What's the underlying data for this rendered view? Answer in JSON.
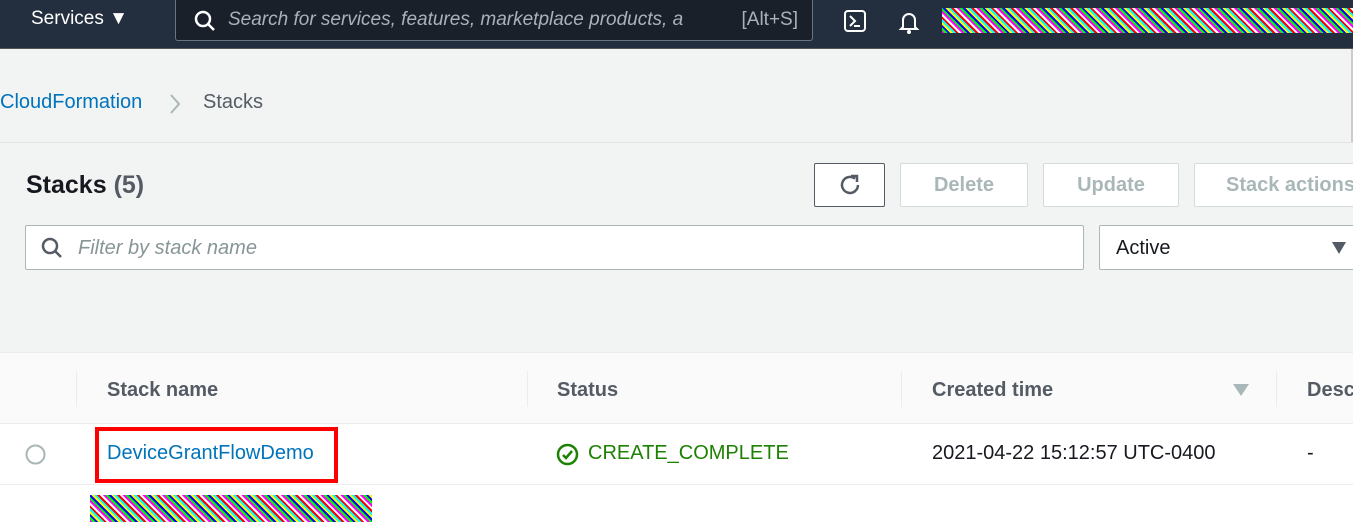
{
  "nav": {
    "services_label": "Services ▼",
    "search_placeholder": "Search for services, features, marketplace products, a",
    "search_shortcut": "[Alt+S]"
  },
  "breadcrumb": {
    "parent": "CloudFormation",
    "current": "Stacks"
  },
  "header": {
    "title": "Stacks",
    "count": "(5)",
    "delete": "Delete",
    "update": "Update",
    "stack_actions": "Stack actions"
  },
  "filter": {
    "placeholder": "Filter by stack name",
    "select_value": "Active"
  },
  "table": {
    "columns": [
      "Stack name",
      "Status",
      "Created time",
      "Desc"
    ],
    "rows": [
      {
        "name": "DeviceGrantFlowDemo",
        "status": "CREATE_COMPLETE",
        "created": "2021-04-22 15:12:57 UTC-0400",
        "description": "-"
      }
    ]
  },
  "colors": {
    "nav_bg": "#232f3e",
    "link": "#0073bb",
    "success": "#1d8102",
    "highlight": "#ff0000"
  }
}
